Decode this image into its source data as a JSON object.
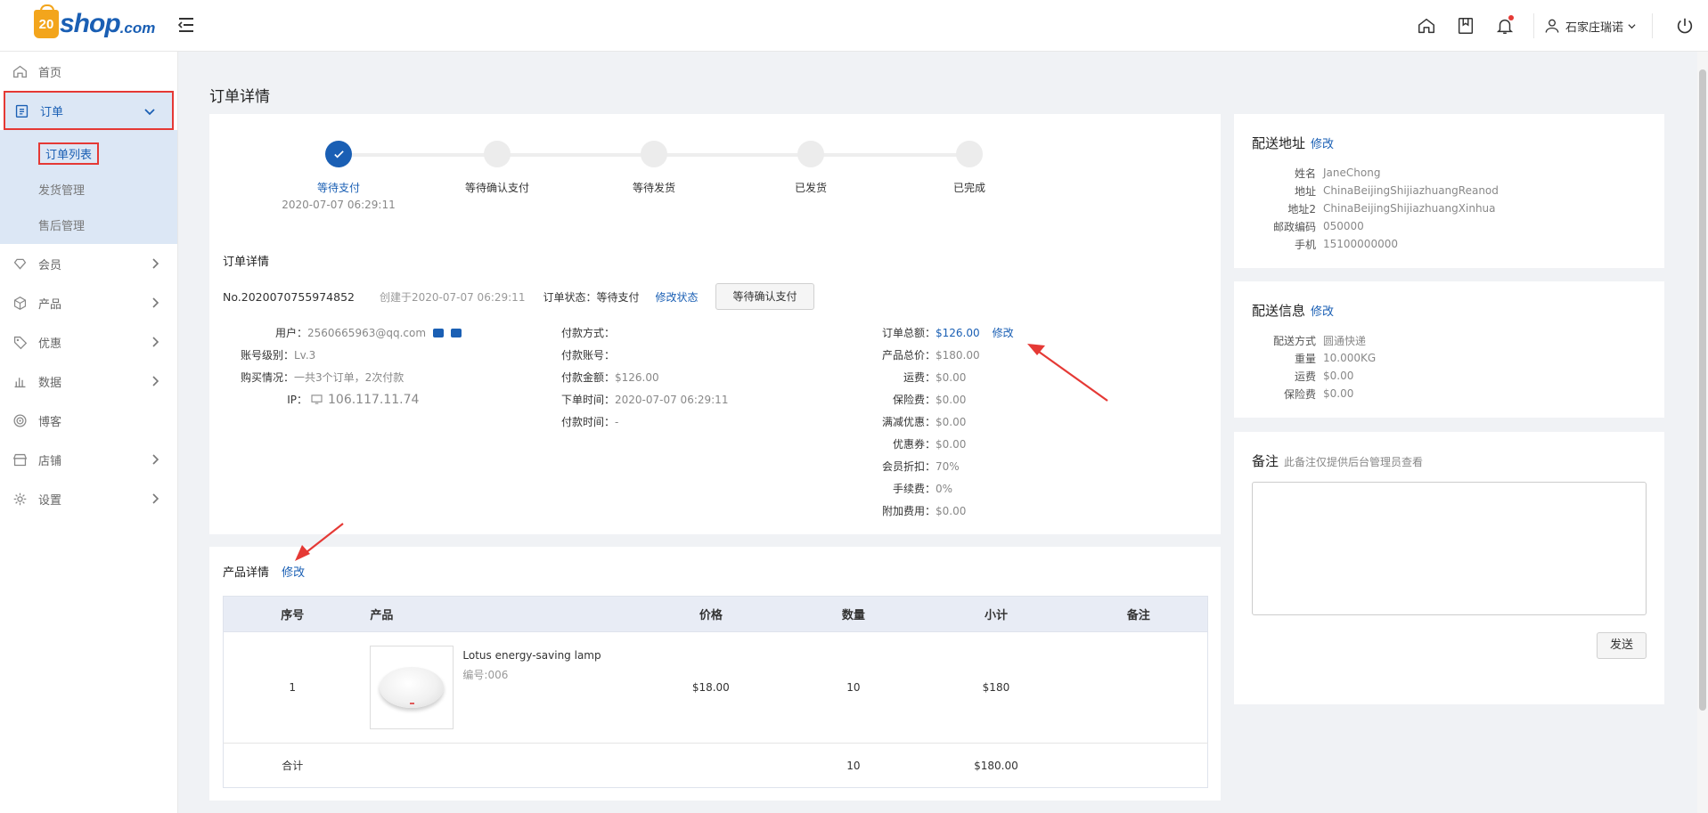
{
  "brand": {
    "logo_mark": "20",
    "logo_word": "shop",
    "logo_suffix": ".com"
  },
  "topbar": {
    "user_name": "石家庄瑞诺",
    "icons": [
      "home-icon",
      "bookmark-icon",
      "bell-icon",
      "user-icon",
      "power-icon"
    ]
  },
  "sidebar": {
    "items": [
      {
        "label": "首页",
        "icon": "home-icon"
      },
      {
        "label": "订单",
        "icon": "clipboard-icon",
        "active": true
      },
      {
        "label": "会员",
        "icon": "diamond-icon"
      },
      {
        "label": "产品",
        "icon": "box-icon"
      },
      {
        "label": "优惠",
        "icon": "tag-icon"
      },
      {
        "label": "数据",
        "icon": "bar-chart-icon"
      },
      {
        "label": "博客",
        "icon": "target-icon"
      },
      {
        "label": "店铺",
        "icon": "store-icon"
      },
      {
        "label": "设置",
        "icon": "gear-icon"
      }
    ],
    "sub_items": [
      "订单列表",
      "发货管理",
      "售后管理"
    ]
  },
  "page_title": "订单详情",
  "steps": [
    {
      "label": "等待支付",
      "time": "2020-07-07 06:29:11",
      "done": true
    },
    {
      "label": "等待确认支付",
      "time": ""
    },
    {
      "label": "等待发货",
      "time": ""
    },
    {
      "label": "已发货",
      "time": ""
    },
    {
      "label": "已完成",
      "time": ""
    }
  ],
  "order": {
    "section_title": "订单详情",
    "number": "No.2020070755974852",
    "created": "创建于2020-07-07 06:29:11",
    "status": "订单状态：等待支付",
    "modify_status": "修改状态",
    "confirm_button": "等待确认支付",
    "user": {
      "user_label": "用户：",
      "user_value": "2560665963@qq.com",
      "level_label": "账号级别：",
      "level_value": "Lv.3",
      "purchase_label": "购买情况：",
      "purchase_value": "一共3个订单，2次付款",
      "ip_label": "IP：",
      "ip_value": "106.117.11.74"
    },
    "payment": {
      "method_label": "付款方式：",
      "method_value": "",
      "account_label": "付款账号：",
      "account_value": "",
      "amount_label": "付款金额：",
      "amount_value": "$126.00",
      "order_time_label": "下单时间：",
      "order_time_value": "2020-07-07 06:29:11",
      "pay_time_label": "付款时间：",
      "pay_time_value": "-"
    },
    "totals": {
      "total_label": "订单总额：",
      "total_value": "$126.00",
      "total_modify": "修改",
      "product_label": "产品总价：",
      "product_value": "$180.00",
      "freight_label": "运费：",
      "freight_value": "$0.00",
      "insurance_label": "保险费：",
      "insurance_value": "$0.00",
      "discount_label": "满减优惠：",
      "discount_value": "$0.00",
      "coupon_label": "优惠券：",
      "coupon_value": "$0.00",
      "member_label": "会员折扣：",
      "member_value": "70%",
      "fee_label": "手续费：",
      "fee_value": "0%",
      "extra_label": "附加费用：",
      "extra_value": "$0.00"
    }
  },
  "products": {
    "title": "产品详情",
    "modify": "修改",
    "headers": [
      "序号",
      "产品",
      "价格",
      "数量",
      "小计",
      "备注"
    ],
    "rows": [
      {
        "index": "1",
        "name": "Lotus energy-saving lamp",
        "code": "编号:006",
        "price": "$18.00",
        "qty": "10",
        "subtotal": "$180",
        "note": ""
      }
    ],
    "total": {
      "label": "合计",
      "qty": "10",
      "subtotal": "$180.00"
    }
  },
  "address": {
    "title": "配送地址",
    "modify": "修改",
    "rows": [
      {
        "k": "姓名",
        "v": "JaneChong"
      },
      {
        "k": "地址",
        "v": "ChinaBeijingShijiazhuangReanod"
      },
      {
        "k": "地址2",
        "v": "ChinaBeijingShijiazhuangXinhua"
      },
      {
        "k": "邮政编码",
        "v": "050000"
      },
      {
        "k": "手机",
        "v": "15100000000"
      }
    ]
  },
  "shipping": {
    "title": "配送信息",
    "modify": "修改",
    "rows": [
      {
        "k": "配送方式",
        "v": "圆通快递"
      },
      {
        "k": "重量",
        "v": "10.000KG"
      },
      {
        "k": "运费",
        "v": "$0.00"
      },
      {
        "k": "保险费",
        "v": "$0.00"
      }
    ]
  },
  "note": {
    "title": "备注",
    "hint": "此备注仅提供后台管理员查看",
    "send": "发送"
  },
  "colors": {
    "primary": "#1a5fb4",
    "highlight": "#e53935",
    "logo_orange": "#f3a51c"
  }
}
